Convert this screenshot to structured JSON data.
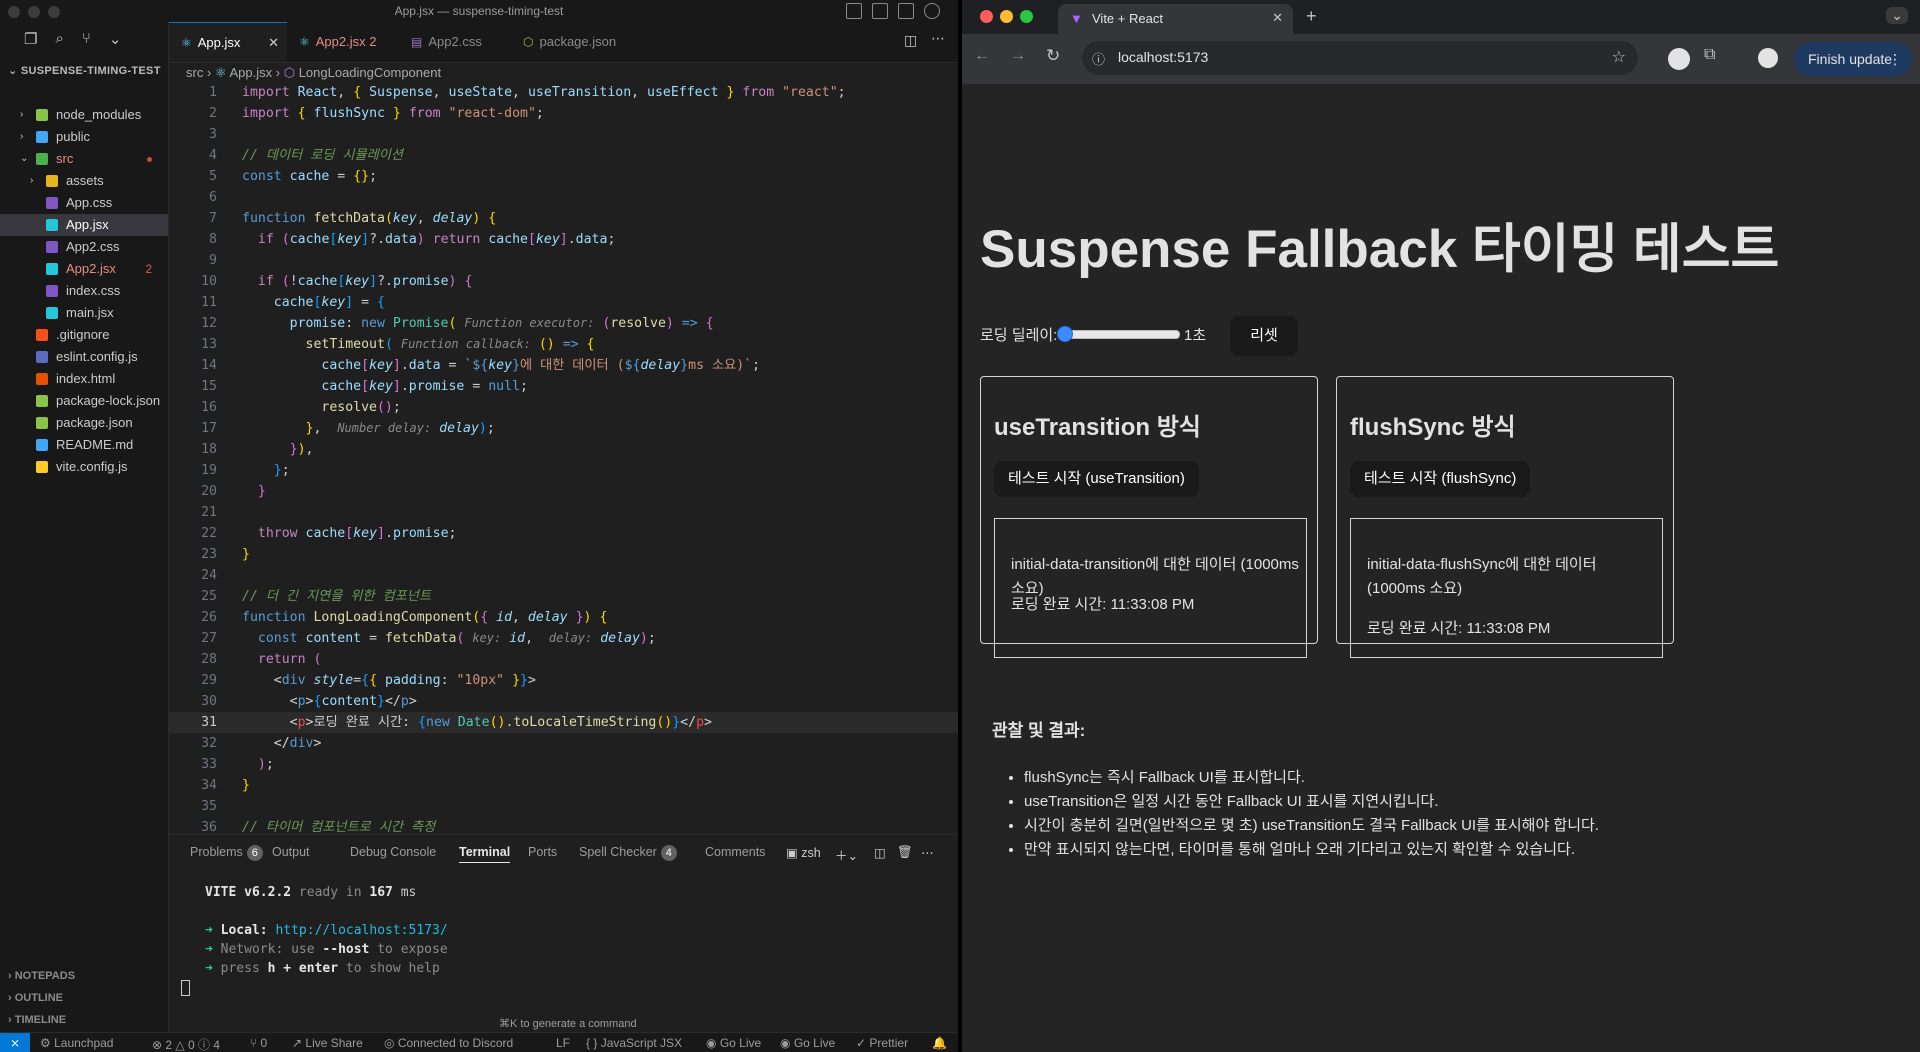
{
  "vscode": {
    "window_title": "App.jsx — suspense-timing-test",
    "explorer": {
      "project": "SUSPENSE-TIMING-TEST",
      "items": [
        {
          "label": "node_modules",
          "color": "#cccccc",
          "icon": "folder-node-icon"
        },
        {
          "label": "public",
          "color": "#cccccc",
          "icon": "folder-public-icon"
        },
        {
          "label": "src",
          "color": "#e78d83",
          "icon": "folder-src-icon"
        },
        {
          "label": "assets",
          "color": "#cccccc",
          "icon": "folder-icon"
        },
        {
          "label": "App.css",
          "color": "#cccccc",
          "icon": "css-icon"
        },
        {
          "label": "App.jsx",
          "color": "#ffffff",
          "icon": "react-icon"
        },
        {
          "label": "App2.css",
          "color": "#cccccc",
          "icon": "css-icon"
        },
        {
          "label": "App2.jsx",
          "color": "#e78d83",
          "icon": "react-icon",
          "badge": "2"
        },
        {
          "label": "index.css",
          "color": "#cccccc",
          "icon": "css-icon"
        },
        {
          "label": "main.jsx",
          "color": "#cccccc",
          "icon": "react-icon"
        },
        {
          "label": ".gitignore",
          "color": "#cccccc",
          "icon": "git-icon"
        },
        {
          "label": "eslint.config.js",
          "color": "#cccccc",
          "icon": "eslint-icon"
        },
        {
          "label": "index.html",
          "color": "#cccccc",
          "icon": "html-icon"
        },
        {
          "label": "package-lock.json",
          "color": "#cccccc",
          "icon": "node-icon"
        },
        {
          "label": "package.json",
          "color": "#cccccc",
          "icon": "node-icon"
        },
        {
          "label": "README.md",
          "color": "#cccccc",
          "icon": "info-icon"
        },
        {
          "label": "vite.config.js",
          "color": "#cccccc",
          "icon": "vite-icon"
        }
      ],
      "sections": [
        "NOTEPADS",
        "OUTLINE",
        "TIMELINE"
      ]
    },
    "tabs": [
      {
        "label": "App.jsx",
        "active": true
      },
      {
        "label": "App2.jsx",
        "badge": "2"
      },
      {
        "label": "App2.css"
      },
      {
        "label": "package.json"
      }
    ],
    "breadcrumb": {
      "folder": "src",
      "file": "App.jsx",
      "symbol": "LongLoadingComponent"
    },
    "panel": {
      "tabs": [
        {
          "label": "Problems",
          "badge": "6"
        },
        {
          "label": "Output"
        },
        {
          "label": "Debug Console"
        },
        {
          "label": "Terminal"
        },
        {
          "label": "Ports"
        },
        {
          "label": "Spell Checker",
          "badge": "4"
        },
        {
          "label": "Comments"
        }
      ],
      "shell": "zsh",
      "terminal": {
        "vite": "VITE v6.2.2",
        "ready": "ready in",
        "ms_value": "167",
        "ms_unit": "ms",
        "local_label": "Local:",
        "local_url": "http://localhost:5173/",
        "network_label": "Network:",
        "network_text": "use",
        "network_flag": "--host",
        "network_tail": "to expose",
        "help_pre": "press",
        "help_key": "h + enter",
        "help_tail": "to show help"
      },
      "hint": "⌘K to generate a command"
    },
    "status": {
      "launchpad": "Launchpad",
      "problems": "⊗ 2 △ 0 ⓘ 4",
      "ports": "0",
      "live_share": "Live Share",
      "discord": "Connected to Discord",
      "eol": "LF",
      "lang": "JavaScript JSX",
      "go_live_1": "Go Live",
      "go_live_2": "Go Live",
      "prettier": "Prettier"
    }
  },
  "chrome": {
    "tab_title": "Vite + React",
    "url": "localhost:5173",
    "finish_update": "Finish update",
    "page": {
      "h1": "Suspense Fallback 타이밍 테스트",
      "delay_label": "로딩 딜레이:",
      "delay_value": "1초",
      "delay_fraction": 0.0,
      "reset": "리셋",
      "cards": [
        {
          "title": "useTransition 방식",
          "button": "테스트 시작 (useTransition)",
          "data": "initial-data-transition에 대한 데이터 (1000ms 소요)",
          "time": "로딩 완료 시간: 11:33:08 PM"
        },
        {
          "title": "flushSync 방식",
          "button": "테스트 시작 (flushSync)",
          "data": "initial-data-flushSync에 대한 데이터 (1000ms 소요)",
          "time": "로딩 완료 시간: 11:33:08 PM"
        }
      ],
      "observations_title": "관찰 및 결과:",
      "observations": [
        "flushSync는 즉시 Fallback UI를 표시합니다.",
        "useTransition은 일정 시간 동안 Fallback UI 표시를 지연시킵니다.",
        "시간이 충분히 길면(일반적으로 몇 초) useTransition도 결국 Fallback UI를 표시해야 합니다.",
        "만약 표시되지 않는다면, 타이머를 통해 얼마나 오래 기다리고 있는지 확인할 수 있습니다."
      ]
    }
  }
}
